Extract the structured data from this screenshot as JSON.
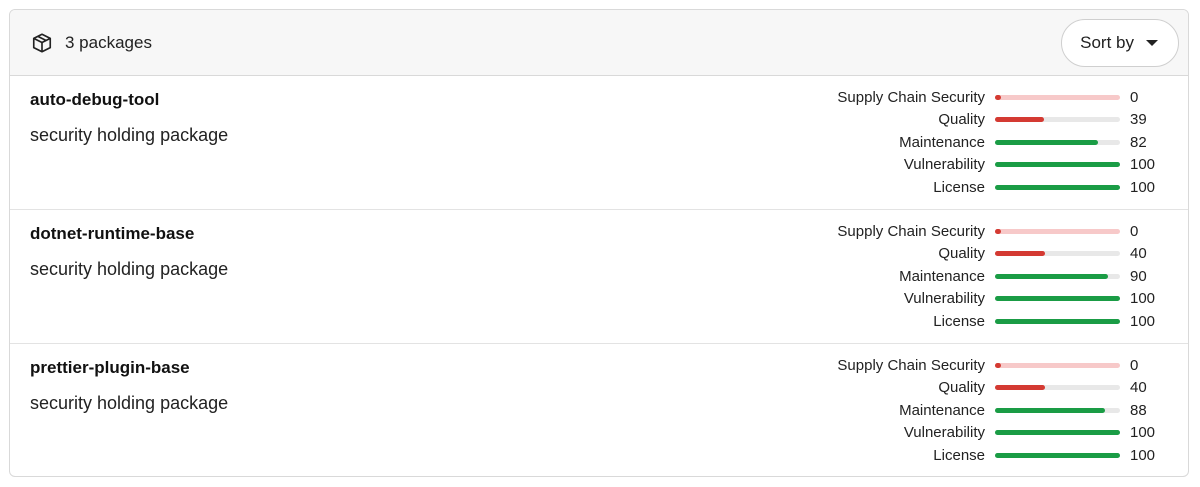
{
  "header": {
    "count_label": "3 packages",
    "sort_label": "Sort by"
  },
  "colors": {
    "red": "#d43a32",
    "green": "#1a9c45",
    "track": "#e8e8e8",
    "track_low": "#f7c9c9"
  },
  "icons": {
    "package": "package-icon",
    "sort": "caret-down-icon"
  },
  "packages": [
    {
      "name": "auto-debug-tool",
      "description": "security holding package",
      "scores": [
        {
          "label": "Supply Chain Security",
          "value": "0",
          "level": 0,
          "color": "red"
        },
        {
          "label": "Quality",
          "value": "39",
          "level": 39,
          "color": "red"
        },
        {
          "label": "Maintenance",
          "value": "82",
          "level": 82,
          "color": "green"
        },
        {
          "label": "Vulnerability",
          "value": "100",
          "level": 100,
          "color": "green"
        },
        {
          "label": "License",
          "value": "100",
          "level": 100,
          "color": "green"
        }
      ]
    },
    {
      "name": "dotnet-runtime-base",
      "description": "security holding package",
      "scores": [
        {
          "label": "Supply Chain Security",
          "value": "0",
          "level": 0,
          "color": "red"
        },
        {
          "label": "Quality",
          "value": "40",
          "level": 40,
          "color": "red"
        },
        {
          "label": "Maintenance",
          "value": "90",
          "level": 90,
          "color": "green"
        },
        {
          "label": "Vulnerability",
          "value": "100",
          "level": 100,
          "color": "green"
        },
        {
          "label": "License",
          "value": "100",
          "level": 100,
          "color": "green"
        }
      ]
    },
    {
      "name": "prettier-plugin-base",
      "description": "security holding package",
      "scores": [
        {
          "label": "Supply Chain Security",
          "value": "0",
          "level": 0,
          "color": "red"
        },
        {
          "label": "Quality",
          "value": "40",
          "level": 40,
          "color": "red"
        },
        {
          "label": "Maintenance",
          "value": "88",
          "level": 88,
          "color": "green"
        },
        {
          "label": "Vulnerability",
          "value": "100",
          "level": 100,
          "color": "green"
        },
        {
          "label": "License",
          "value": "100",
          "level": 100,
          "color": "green"
        }
      ]
    }
  ]
}
